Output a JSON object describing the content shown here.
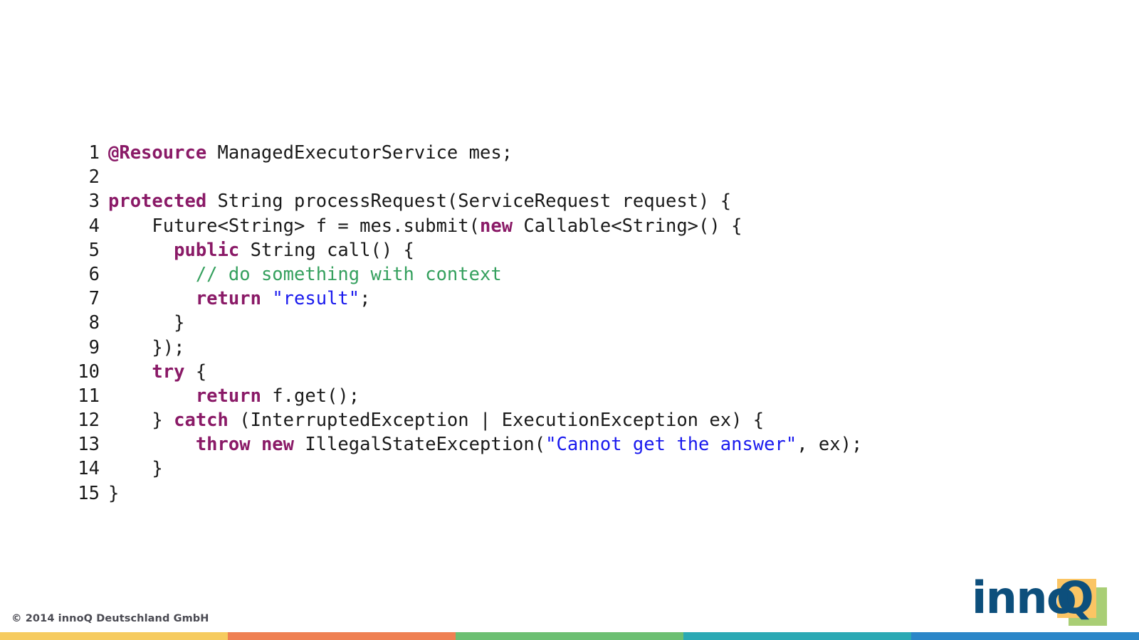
{
  "slide": {
    "background_color": "#ffffff",
    "code": {
      "language": "java",
      "font": "monospace",
      "colors": {
        "keyword": "#8a1a67",
        "comment": "#35a05e",
        "string": "#1a1aee",
        "plain": "#1a1a1a"
      },
      "lines": [
        {
          "number": "1",
          "tokens": [
            {
              "t": "@Resource",
              "k": "kw"
            },
            {
              "t": " ManagedExecutorService mes;",
              "k": "plain"
            }
          ]
        },
        {
          "number": "2",
          "tokens": [
            {
              "t": "",
              "k": "plain"
            }
          ]
        },
        {
          "number": "3",
          "tokens": [
            {
              "t": "protected",
              "k": "kw"
            },
            {
              "t": " String processRequest(ServiceRequest request) {",
              "k": "plain"
            }
          ]
        },
        {
          "number": "4",
          "tokens": [
            {
              "t": "    Future<String> f = mes.submit(",
              "k": "plain"
            },
            {
              "t": "new",
              "k": "kw"
            },
            {
              "t": " Callable<String>() {",
              "k": "plain"
            }
          ]
        },
        {
          "number": "5",
          "tokens": [
            {
              "t": "      ",
              "k": "plain"
            },
            {
              "t": "public",
              "k": "kw"
            },
            {
              "t": " String call() {",
              "k": "plain"
            }
          ]
        },
        {
          "number": "6",
          "tokens": [
            {
              "t": "        ",
              "k": "plain"
            },
            {
              "t": "// do something with context",
              "k": "comment"
            }
          ]
        },
        {
          "number": "7",
          "tokens": [
            {
              "t": "        ",
              "k": "plain"
            },
            {
              "t": "return",
              "k": "kw"
            },
            {
              "t": " ",
              "k": "plain"
            },
            {
              "t": "\"result\"",
              "k": "string"
            },
            {
              "t": ";",
              "k": "plain"
            }
          ]
        },
        {
          "number": "8",
          "tokens": [
            {
              "t": "      }",
              "k": "plain"
            }
          ]
        },
        {
          "number": "9",
          "tokens": [
            {
              "t": "    });",
              "k": "plain"
            }
          ]
        },
        {
          "number": "10",
          "tokens": [
            {
              "t": "    ",
              "k": "plain"
            },
            {
              "t": "try",
              "k": "kw"
            },
            {
              "t": " {",
              "k": "plain"
            }
          ]
        },
        {
          "number": "11",
          "tokens": [
            {
              "t": "        ",
              "k": "plain"
            },
            {
              "t": "return",
              "k": "kw"
            },
            {
              "t": " f.get();",
              "k": "plain"
            }
          ]
        },
        {
          "number": "12",
          "tokens": [
            {
              "t": "    } ",
              "k": "plain"
            },
            {
              "t": "catch",
              "k": "kw"
            },
            {
              "t": " (InterruptedException | ExecutionException ex) {",
              "k": "plain"
            }
          ]
        },
        {
          "number": "13",
          "tokens": [
            {
              "t": "        ",
              "k": "plain"
            },
            {
              "t": "throw new",
              "k": "kw"
            },
            {
              "t": " IllegalStateException(",
              "k": "plain"
            },
            {
              "t": "\"Cannot get the answer\"",
              "k": "string"
            },
            {
              "t": ", ex);",
              "k": "plain"
            }
          ]
        },
        {
          "number": "14",
          "tokens": [
            {
              "t": "    }",
              "k": "plain"
            }
          ]
        },
        {
          "number": "15",
          "tokens": [
            {
              "t": "}",
              "k": "plain"
            }
          ]
        }
      ]
    },
    "footer": {
      "copyright": "© 2014 innoQ Deutschland GmbH",
      "color_bar": [
        {
          "name": "yellow",
          "color": "#f6cb5f"
        },
        {
          "name": "orange",
          "color": "#ef8052"
        },
        {
          "name": "green",
          "color": "#6cbf72"
        },
        {
          "name": "teal",
          "color": "#2ba9b4"
        },
        {
          "name": "blue",
          "color": "#2b86c8"
        }
      ],
      "logo": {
        "word_left": "inno",
        "word_right": "Q",
        "text_color": "#0d4f7c",
        "amber_square_color": "#fbc564",
        "green_square_color": "#a9ce75"
      }
    }
  }
}
